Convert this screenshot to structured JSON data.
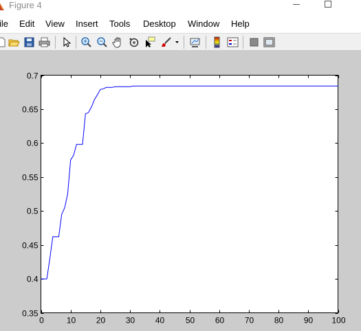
{
  "window": {
    "title": "Figure 4"
  },
  "menu": {
    "items": [
      {
        "label": "ile"
      },
      {
        "label": "Edit"
      },
      {
        "label": "View"
      },
      {
        "label": "Insert"
      },
      {
        "label": "Tools"
      },
      {
        "label": "Desktop"
      },
      {
        "label": "Window"
      },
      {
        "label": "Help"
      }
    ]
  },
  "toolbar": {
    "icons": [
      "new-figure-icon",
      "open-file-icon",
      "save-icon",
      "print-icon",
      "edit-plot-arrow-icon",
      "zoom-in-icon",
      "zoom-out-icon",
      "pan-hand-icon",
      "rotate-3d-icon",
      "data-cursor-icon",
      "brush-icon",
      "brush-dropdown-icon",
      "link-plot-icon",
      "colorbar-icon",
      "legend-icon",
      "hide-plot-tools-icon",
      "show-plot-tools-icon"
    ]
  },
  "colors": {
    "line": "#0000ff",
    "figure_bg": "#cccccc",
    "axes_bg": "#ffffff"
  },
  "chart_data": {
    "type": "line",
    "title": "",
    "xlabel": "",
    "ylabel": "",
    "xlim": [
      0,
      100
    ],
    "ylim": [
      0.35,
      0.7
    ],
    "xticks": [
      0,
      10,
      20,
      30,
      40,
      50,
      60,
      70,
      80,
      90,
      100
    ],
    "yticks": [
      0.35,
      0.4,
      0.45,
      0.5,
      0.55,
      0.6,
      0.65,
      0.7
    ],
    "grid": false,
    "series": [
      {
        "color": "#0000ff",
        "x": [
          0,
          1,
          2,
          3,
          4,
          5,
          6,
          7,
          8,
          9,
          10,
          11,
          12,
          13,
          14,
          15,
          16,
          17,
          18,
          19,
          20,
          21,
          22,
          23,
          24,
          25,
          26,
          27,
          28,
          29,
          30,
          31,
          35,
          40,
          50,
          60,
          70,
          80,
          90,
          100
        ],
        "y": [
          0.4,
          0.4,
          0.4,
          0.43,
          0.462,
          0.462,
          0.462,
          0.495,
          0.505,
          0.525,
          0.575,
          0.582,
          0.598,
          0.598,
          0.598,
          0.643,
          0.645,
          0.653,
          0.664,
          0.671,
          0.679,
          0.68,
          0.682,
          0.682,
          0.682,
          0.683,
          0.683,
          0.683,
          0.683,
          0.683,
          0.683,
          0.684,
          0.684,
          0.684,
          0.684,
          0.684,
          0.684,
          0.684,
          0.684,
          0.684
        ]
      }
    ]
  }
}
